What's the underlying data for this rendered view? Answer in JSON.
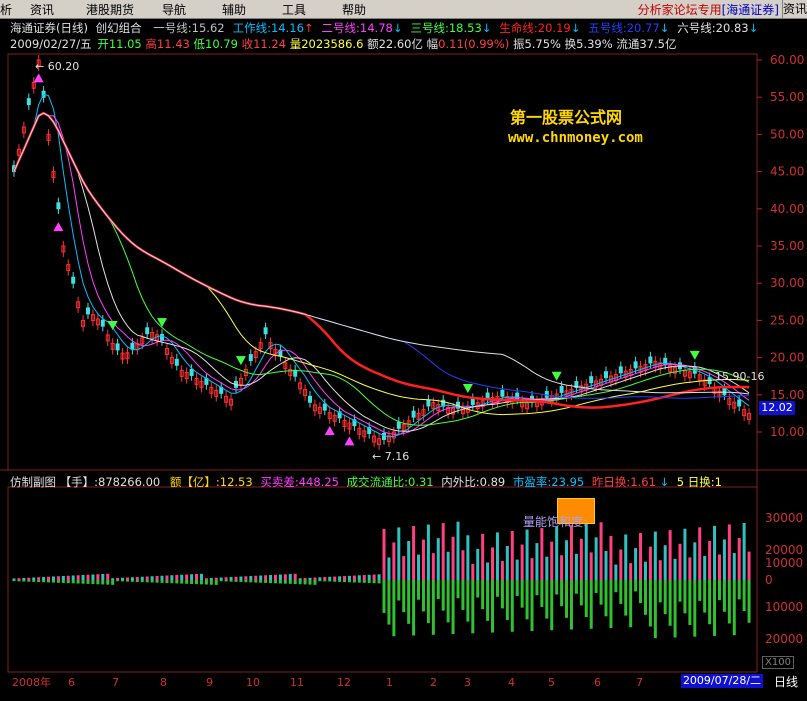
{
  "menubar": {
    "items": [
      "析",
      "资讯",
      "港股期货",
      "导航",
      "辅助",
      "工具",
      "帮助"
    ],
    "forum_label": "分析家论坛专用",
    "broker_label": "[海通证券]",
    "right_label": "资讯"
  },
  "header": {
    "stock_title": "海通证券(日线)",
    "indicator_name": "创幻组合",
    "lines": [
      {
        "label": "一号线",
        "value": "15.62",
        "color": "#c0c0c0",
        "arrow": ""
      },
      {
        "label": "工作线",
        "value": "14.16",
        "color": "#00c0ff",
        "arrow": "↑",
        "arrow_color": "#ff4040"
      },
      {
        "label": "二号线",
        "value": "14.78",
        "color": "#ff40ff",
        "arrow": "↓",
        "arrow_color": "#00c0ff"
      },
      {
        "label": "三号线",
        "value": "18.53",
        "color": "#40ff40",
        "arrow": "↓",
        "arrow_color": "#00c0ff"
      },
      {
        "label": "生命线",
        "value": "20.19",
        "color": "#ff2020",
        "arrow": "↓",
        "arrow_color": "#00c0ff"
      },
      {
        "label": "五号线",
        "value": "20.77",
        "color": "#2040ff",
        "arrow": "↓",
        "arrow_color": "#00c0ff"
      },
      {
        "label": "六号线",
        "value": "20.83",
        "color": "#e0e0e0",
        "arrow": "↓",
        "arrow_color": "#00c0ff"
      }
    ]
  },
  "quote": {
    "date": "2009/02/27/五",
    "open_label": "开",
    "open": "11.05",
    "high_label": "高",
    "high": "11.43",
    "low_label": "低",
    "low": "10.79",
    "close_label": "收",
    "close": "11.24",
    "vol_label": "量",
    "vol": "2023586.6",
    "amt_label": "额",
    "amt": "22.60亿",
    "chg_label": "幅",
    "chg": "0.11(0.99%)",
    "amp_label": "振",
    "amp": "5.75%",
    "turn_label": "换",
    "turn": "5.39%",
    "float_label": "流通",
    "float": "37.5亿"
  },
  "watermark": {
    "line1": "第一股票公式网",
    "line2": "www.chnmoney.com"
  },
  "price_axis": {
    "ticks": [
      "60.00",
      "55.00",
      "50.00",
      "45.00",
      "40.00",
      "35.00",
      "30.00",
      "25.00",
      "20.00",
      "15.00",
      "10.00"
    ],
    "current_price": "12.02"
  },
  "annotations": {
    "high_label": "60.20",
    "low_label": "7.16",
    "range_label": "15.90-16"
  },
  "sub_header": {
    "name": "仿制副图",
    "hand_label": "【手】",
    "hand_value": ":878266.00",
    "amt_label": "额【亿】",
    "amt_value": ":12.53",
    "buysell_label": "买卖差",
    "buysell_value": ":448.25",
    "turnover_label": "成交流通比",
    "turnover_value": ":0.31",
    "inout_label": "内外比",
    "inout_value": ":0.89",
    "pe_label": "市盈率",
    "pe_value": ":23.95",
    "prev_label": "昨日换",
    "prev_value": ":1.61",
    "five_label": "5 日换",
    "five_value": ":1",
    "box_label": "量能饱和度:"
  },
  "sub_axis": {
    "ticks": [
      "30000",
      "20000",
      "10000",
      "0",
      "10000",
      "20000"
    ],
    "scale_label": "X100"
  },
  "time_axis": {
    "months": [
      "2008年",
      "6",
      "7",
      "8",
      "9",
      "10",
      "11",
      "12",
      "1",
      "2",
      "3",
      "4",
      "5",
      "6",
      "7"
    ],
    "current_date": "2009/07/28/二",
    "period": "日线"
  }
}
